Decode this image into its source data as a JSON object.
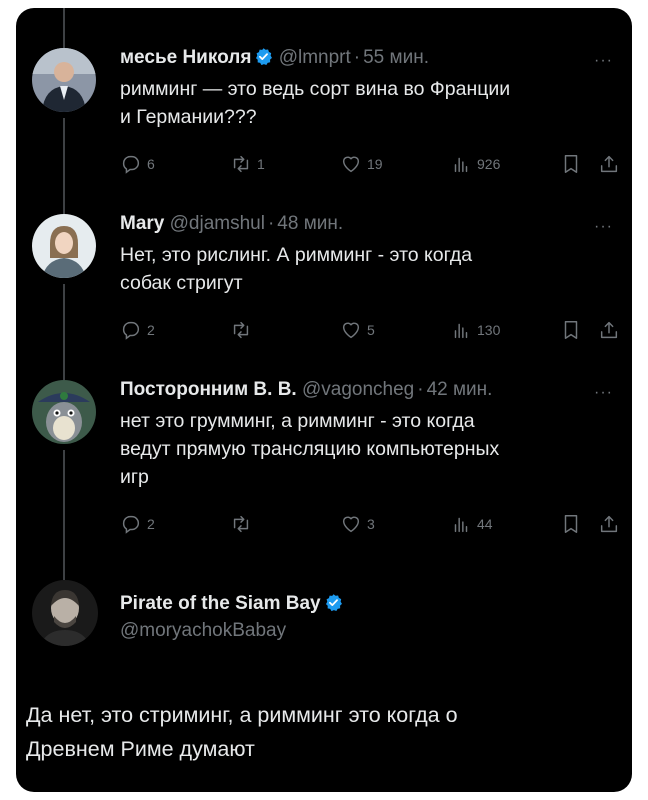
{
  "tweets": [
    {
      "name": "месье Николя",
      "verified": true,
      "handle": "@lmnprt",
      "time": "55 мин.",
      "text_lines": [
        "римминг — это ведь сорт вина во Франции",
        "и Германии???"
      ],
      "replies": "6",
      "retweets": "1",
      "likes": "19",
      "views": "926"
    },
    {
      "name": "Mary",
      "verified": false,
      "handle": "@djamshul",
      "time": "48 мин.",
      "text_lines": [
        "Нет, это рислинг. А римминг - это когда",
        "собак стригут"
      ],
      "replies": "2",
      "retweets": "",
      "likes": "5",
      "views": "130"
    },
    {
      "name": "Посторонним В. В.",
      "verified": false,
      "handle": "@vagoncheg",
      "time": "42 мин.",
      "text_lines": [
        "нет это грумминг, а римминг - это когда",
        "ведут прямую трансляцию компьютерных",
        "игр"
      ],
      "replies": "2",
      "retweets": "",
      "likes": "3",
      "views": "44"
    }
  ],
  "main_tweet": {
    "name": "Pirate of the Siam Bay",
    "verified": true,
    "handle": "@moryachokBabay",
    "text_lines": [
      "Да нет, это стриминг, а римминг это когда о",
      "Древнем Риме думают"
    ]
  },
  "icons": {
    "reply": "reply-icon",
    "retweet": "retweet-icon",
    "like": "heart-icon",
    "views": "views-icon",
    "bookmark": "bookmark-icon",
    "share": "share-icon",
    "more": "more-icon",
    "verified": "verified-badge-icon"
  },
  "colors": {
    "background": "#000000",
    "text": "#e7e9ea",
    "muted": "#71767b",
    "verified": "#1d9bf0"
  }
}
